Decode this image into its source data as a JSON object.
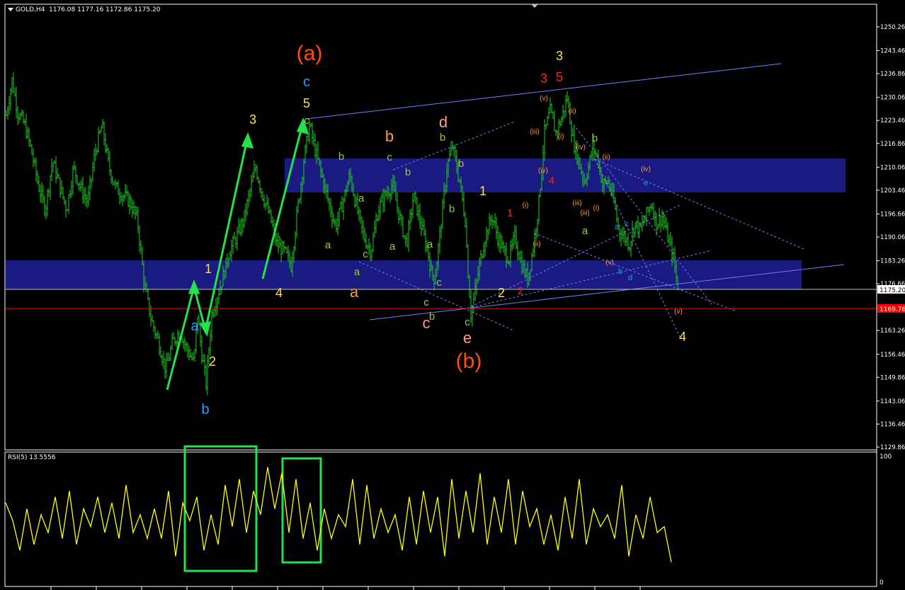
{
  "window": {
    "symbol_caption": "GOLD,H4",
    "ohlc_caption": "1176.08 1177.16 1172.86 1175.20"
  },
  "colors": {
    "bg": "#000000",
    "candles": "#22cc22",
    "rsi": "#ffff00",
    "zone": "#1a1a80",
    "trend": "#6f7fff",
    "arrow": "#22e34a",
    "box": "#22e34a",
    "support": "#ff0000",
    "axis": "#ffffff"
  },
  "chart_data": [
    {
      "type": "line",
      "title": "GOLD,H4",
      "ylim": [
        1129.86,
        1250.26
      ],
      "y_ticks": [
        "1250.26",
        "1243.46",
        "1236.86",
        "1230.06",
        "1223.46",
        "1216.86",
        "1210.06",
        "1203.46",
        "1196.66",
        "1190.06",
        "1183.26",
        "1176.66",
        "1169.86",
        "1163.26",
        "1156.46",
        "1149.86",
        "1143.06",
        "1136.46",
        "1129.86"
      ],
      "last_price": {
        "value": 1175.2,
        "label": "1175.20"
      },
      "support_line": {
        "value": 1169.76,
        "label": "1169.76"
      },
      "price_path": [
        [
          0,
          1225
        ],
        [
          8,
          1235
        ],
        [
          16,
          1226
        ],
        [
          26,
          1222
        ],
        [
          35,
          1215
        ],
        [
          45,
          1205
        ],
        [
          55,
          1198
        ],
        [
          65,
          1212
        ],
        [
          75,
          1205
        ],
        [
          85,
          1198
        ],
        [
          95,
          1210
        ],
        [
          105,
          1204
        ],
        [
          115,
          1200
        ],
        [
          125,
          1214
        ],
        [
          135,
          1222
        ],
        [
          145,
          1210
        ],
        [
          155,
          1204
        ],
        [
          165,
          1202
        ],
        [
          175,
          1200
        ],
        [
          185,
          1195
        ],
        [
          195,
          1176
        ],
        [
          205,
          1166
        ],
        [
          215,
          1160
        ],
        [
          225,
          1152
        ],
        [
          235,
          1160
        ],
        [
          245,
          1163
        ],
        [
          255,
          1158
        ],
        [
          265,
          1154
        ],
        [
          270,
          1168
        ],
        [
          275,
          1158
        ],
        [
          282,
          1148
        ],
        [
          290,
          1168
        ],
        [
          296,
          1172
        ],
        [
          305,
          1178
        ],
        [
          315,
          1186
        ],
        [
          325,
          1190
        ],
        [
          335,
          1195
        ],
        [
          345,
          1204
        ],
        [
          352,
          1210
        ],
        [
          362,
          1202
        ],
        [
          372,
          1196
        ],
        [
          382,
          1188
        ],
        [
          392,
          1186
        ],
        [
          402,
          1182
        ],
        [
          410,
          1196
        ],
        [
          420,
          1212
        ],
        [
          428,
          1222
        ],
        [
          436,
          1215
        ],
        [
          445,
          1208
        ],
        [
          455,
          1200
        ],
        [
          465,
          1193
        ],
        [
          475,
          1200
        ],
        [
          485,
          1208
        ],
        [
          495,
          1198
        ],
        [
          505,
          1190
        ],
        [
          515,
          1186
        ],
        [
          525,
          1198
        ],
        [
          535,
          1202
        ],
        [
          545,
          1205
        ],
        [
          555,
          1196
        ],
        [
          565,
          1188
        ],
        [
          575,
          1202
        ],
        [
          585,
          1194
        ],
        [
          595,
          1186
        ],
        [
          600,
          1180
        ],
        [
          605,
          1178
        ],
        [
          615,
          1196
        ],
        [
          622,
          1210
        ],
        [
          630,
          1216
        ],
        [
          640,
          1206
        ],
        [
          648,
          1195
        ],
        [
          652,
          1180
        ],
        [
          656,
          1168
        ],
        [
          660,
          1172
        ],
        [
          668,
          1182
        ],
        [
          676,
          1190
        ],
        [
          686,
          1196
        ],
        [
          694,
          1190
        ],
        [
          702,
          1186
        ],
        [
          710,
          1184
        ],
        [
          718,
          1190
        ],
        [
          728,
          1182
        ],
        [
          736,
          1178
        ],
        [
          744,
          1187
        ],
        [
          752,
          1200
        ],
        [
          760,
          1220
        ],
        [
          768,
          1226
        ],
        [
          776,
          1220
        ],
        [
          784,
          1224
        ],
        [
          792,
          1230
        ],
        [
          800,
          1218
        ],
        [
          808,
          1212
        ],
        [
          816,
          1206
        ],
        [
          822,
          1210
        ],
        [
          828,
          1216
        ],
        [
          836,
          1212
        ],
        [
          842,
          1205
        ],
        [
          850,
          1206
        ],
        [
          858,
          1200
        ],
        [
          865,
          1192
        ],
        [
          873,
          1190
        ],
        [
          880,
          1188
        ],
        [
          887,
          1194
        ],
        [
          895,
          1192
        ],
        [
          903,
          1196
        ],
        [
          911,
          1200
        ],
        [
          918,
          1194
        ],
        [
          926,
          1196
        ],
        [
          934,
          1190
        ],
        [
          942,
          1184
        ],
        [
          948,
          1176
        ]
      ]
    },
    {
      "type": "line",
      "title": "RSI(5) 13.5556",
      "ylim": [
        0,
        100
      ],
      "y_ticks": [
        "100",
        "0"
      ],
      "values": [
        65,
        50,
        25,
        60,
        30,
        55,
        40,
        70,
        35,
        75,
        30,
        60,
        45,
        70,
        40,
        65,
        35,
        80,
        40,
        55,
        35,
        60,
        35,
        75,
        20,
        65,
        50,
        70,
        25,
        55,
        30,
        80,
        45,
        85,
        40,
        75,
        55,
        95,
        60,
        90,
        40,
        85,
        35,
        65,
        25,
        60,
        35,
        55,
        45,
        85,
        30,
        80,
        35,
        60,
        40,
        55,
        25,
        70,
        30,
        75,
        40,
        70,
        20,
        85,
        35,
        75,
        40,
        90,
        30,
        70,
        40,
        85,
        30,
        75,
        45,
        60,
        30,
        55,
        25,
        70,
        35,
        85,
        30,
        60,
        45,
        55,
        35,
        80,
        20,
        55,
        35,
        70,
        40,
        45,
        15
      ]
    }
  ],
  "labels": [
    {
      "t": "(a)",
      "c": "#ff5010",
      "s": 30
    },
    {
      "t": "(b)",
      "c": "#ff5010",
      "s": 30
    },
    {
      "t": "c",
      "c": "#22a0ff",
      "s": 20
    },
    {
      "t": "5",
      "c": "#ffe040",
      "s": 18
    },
    {
      "t": "3",
      "c": "#ffe040",
      "s": 18
    },
    {
      "t": "1",
      "c": "#ffe040",
      "s": 18
    },
    {
      "t": "a",
      "c": "#22a0ff",
      "s": 20
    },
    {
      "t": "2",
      "c": "#ffe040",
      "s": 18
    },
    {
      "t": "b",
      "c": "#22a0ff",
      "s": 20
    },
    {
      "t": "4",
      "c": "#ffe040",
      "s": 18
    },
    {
      "t": "b",
      "c": "#ff9a30",
      "s": 22
    },
    {
      "t": "d",
      "c": "#ff9a80",
      "s": 22
    },
    {
      "t": "a",
      "c": "#ff9a30",
      "s": 22
    },
    {
      "t": "c",
      "c": "#ff9a80",
      "s": 22
    },
    {
      "t": "e",
      "c": "#ff9a80",
      "s": 22
    },
    {
      "t": "1",
      "c": "#ffe040",
      "s": 18
    },
    {
      "t": "2",
      "c": "#ffe040",
      "s": 18
    },
    {
      "t": "3",
      "c": "#ffe040",
      "s": 18
    },
    {
      "t": "5",
      "c": "#ff2020",
      "s": 18
    },
    {
      "t": "3",
      "c": "#ff2020",
      "s": 18
    },
    {
      "t": "4",
      "c": "#ff2020",
      "s": 15
    },
    {
      "t": "1",
      "c": "#ff2020",
      "s": 15
    },
    {
      "t": "2",
      "c": "#ff2020",
      "s": 15
    },
    {
      "t": "4",
      "c": "#ffe040",
      "s": 18
    },
    {
      "t": "c",
      "c": "#99cc33",
      "s": 15
    },
    {
      "t": "b",
      "c": "#99cc33",
      "s": 15
    },
    {
      "t": "c",
      "c": "#99cc33",
      "s": 15
    },
    {
      "t": "b",
      "c": "#99cc33",
      "s": 15
    },
    {
      "t": "a",
      "c": "#99cc33",
      "s": 15
    },
    {
      "t": "b",
      "c": "#99cc33",
      "s": 15
    },
    {
      "t": "a",
      "c": "#99cc33",
      "s": 15
    },
    {
      "t": "a",
      "c": "#99cc33",
      "s": 15
    },
    {
      "t": "b",
      "c": "#99cc33",
      "s": 15
    },
    {
      "t": "c",
      "c": "#99cc33",
      "s": 15
    },
    {
      "t": "a",
      "c": "#99cc33",
      "s": 15
    },
    {
      "t": "a",
      "c": "#99cc33",
      "s": 15
    },
    {
      "t": "b",
      "c": "#99cc33",
      "s": 15
    },
    {
      "t": "c",
      "c": "#99cc33",
      "s": 15
    },
    {
      "t": "b",
      "c": "#99cc33",
      "s": 15
    },
    {
      "t": "c",
      "c": "#99cc33",
      "s": 15
    },
    {
      "t": "b",
      "c": "#99cc33",
      "s": 15
    },
    {
      "t": "a",
      "c": "#99cc33",
      "s": 15
    },
    {
      "t": "c",
      "c": "#99cc33",
      "s": 15
    },
    {
      "t": "(v)",
      "c": "#ff9a30",
      "s": 10
    },
    {
      "t": "(iii)",
      "c": "#ff9a30",
      "s": 10
    },
    {
      "t": "(i)",
      "c": "#ff9a30",
      "s": 10
    },
    {
      "t": "(ii)",
      "c": "#ff9a30",
      "s": 10
    },
    {
      "t": "(iv)",
      "c": "#ff9a30",
      "s": 10
    },
    {
      "t": "(i)",
      "c": "#ff9a30",
      "s": 10
    },
    {
      "t": "(ii)",
      "c": "#ff9a30",
      "s": 10
    },
    {
      "t": "(iv)",
      "c": "#ff9a30",
      "s": 10
    },
    {
      "t": "(ii)",
      "c": "#ff9a30",
      "s": 10
    },
    {
      "t": "(iii)",
      "c": "#ff9a30",
      "s": 10
    },
    {
      "t": "(v)",
      "c": "#ff9a30",
      "s": 10
    },
    {
      "t": "(i)",
      "c": "#ff9a30",
      "s": 10
    },
    {
      "t": "(iv)",
      "c": "#ff9a30",
      "s": 10
    },
    {
      "t": "(iii)",
      "c": "#ff9a30",
      "s": 10
    },
    {
      "t": "(v)",
      "c": "#ff9a30",
      "s": 10
    },
    {
      "t": "e",
      "c": "#22a0ff",
      "s": 11
    },
    {
      "t": "c",
      "c": "#22a0ff",
      "s": 11
    },
    {
      "t": "a",
      "c": "#22a0ff",
      "s": 11
    },
    {
      "t": "b",
      "c": "#22a0ff",
      "s": 11
    },
    {
      "t": "d",
      "c": "#22a0ff",
      "s": 11
    }
  ]
}
